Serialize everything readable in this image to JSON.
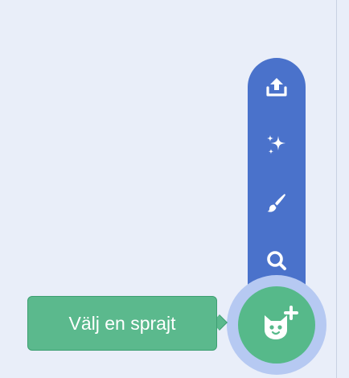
{
  "sprite_menu": {
    "items": [
      {
        "icon": "upload-icon"
      },
      {
        "icon": "surprise-sparkle-icon"
      },
      {
        "icon": "paint-brush-icon"
      },
      {
        "icon": "search-icon"
      }
    ]
  },
  "add_sprite": {
    "icon": "cat-plus-icon",
    "tooltip": "Välj en sprajt"
  },
  "colors": {
    "background": "#e9eef9",
    "menu_blue": "#4a72cb",
    "halo": "#b6c9f2",
    "button_green": "#56b98a",
    "tooltip_green": "#5bb98d"
  }
}
